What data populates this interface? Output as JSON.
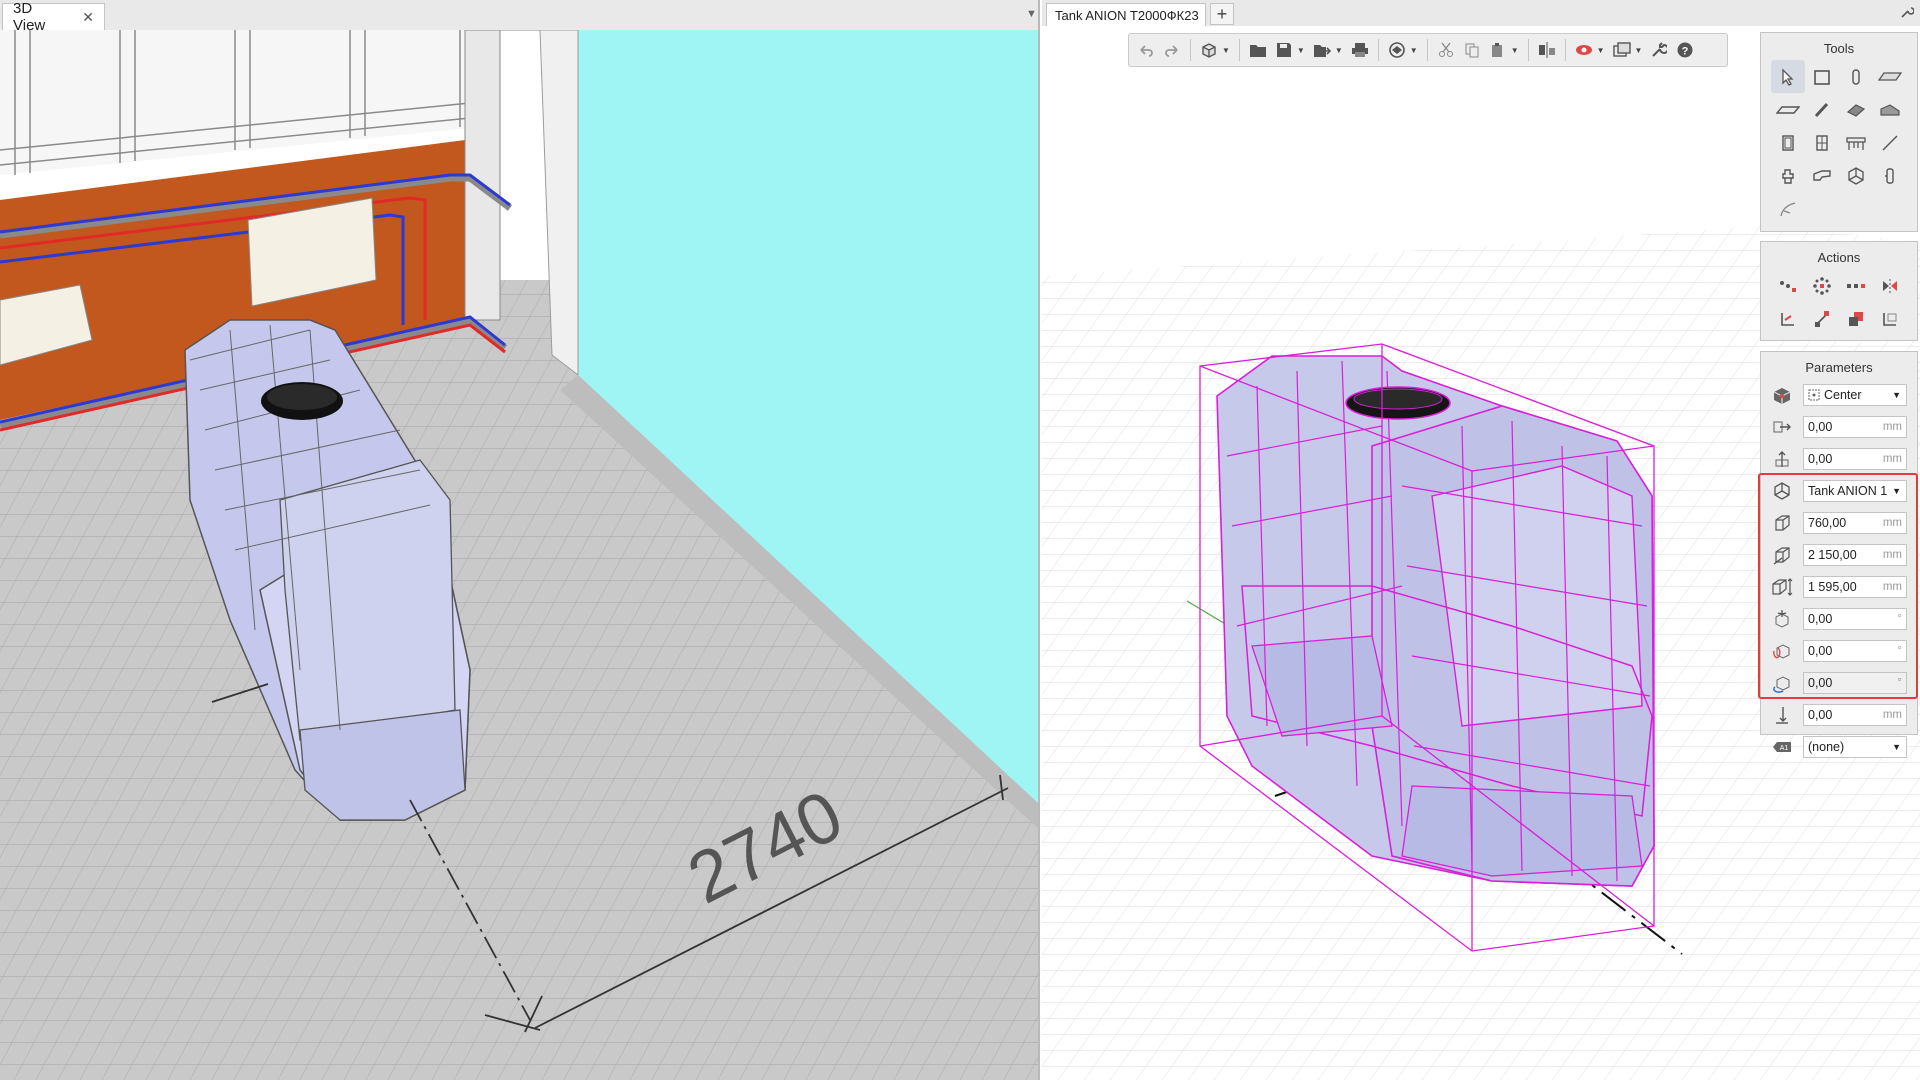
{
  "left_view": {
    "tab_label": "3D View",
    "dimension_label": "2740"
  },
  "right_view": {
    "tab_label": "Tank ANION T2000ФК23",
    "toolbar_icons": [
      "undo-icon",
      "redo-icon",
      "view-cube-icon",
      "open-folder-icon",
      "save-icon",
      "export-icon",
      "print-icon",
      "render-icon",
      "cut-icon",
      "copy-icon",
      "paste-icon",
      "align-icon",
      "visibility-icon",
      "display-mode-icon",
      "settings-wrench-icon",
      "help-icon"
    ]
  },
  "tools_panel": {
    "title": "Tools"
  },
  "actions_panel": {
    "title": "Actions"
  },
  "parameters_panel": {
    "title": "Parameters",
    "anchor_select": "Center",
    "offset_x": "0,00",
    "offset_y": "0,00",
    "model_select": "Tank ANION 1",
    "width": "760,00",
    "length": "2 150,00",
    "height": "1 595,00",
    "rotation_z": "0,00",
    "rotation_x": "0,00",
    "rotation_y": "0,00",
    "elevation": "0,00",
    "layer_select": "(none)",
    "unit_mm": "mm",
    "unit_deg": "°"
  },
  "colors": {
    "accent_highlight": "#e23d3d",
    "tank_fill": "#c5c8ec",
    "wireframe": "#d91fd9",
    "wall_orange": "#c2581e",
    "glass_cyan": "#9ff4f4"
  }
}
